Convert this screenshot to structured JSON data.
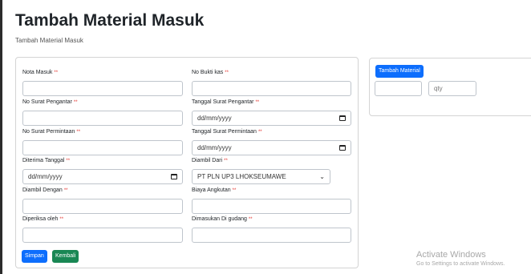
{
  "header": {
    "title": "Tambah Material Masuk",
    "breadcrumb": "Tambah Material Masuk"
  },
  "form": {
    "required_mark": "**",
    "nota_masuk": {
      "label": "Nota Masuk",
      "value": ""
    },
    "no_bukti_kas": {
      "label": "No Bukti kas",
      "value": ""
    },
    "no_surat_pengantar": {
      "label": "No Surat Pengantar",
      "value": ""
    },
    "tanggal_surat_pengantar": {
      "label": "Tanggal Surat Pengantar",
      "value": "dd/mm/yyyy"
    },
    "no_surat_permintaan": {
      "label": "No Surat Permintaan",
      "value": ""
    },
    "tanggal_surat_permintaan": {
      "label": "Tanggal Surat Permintaan",
      "value": "dd/mm/yyyy"
    },
    "diterima_tanggal": {
      "label": "Diterima Tanggal",
      "value": "dd/mm/yyyy"
    },
    "diambil_dari": {
      "label": "Diambil Dari",
      "value": "PT PLN UP3 LHOKSEUMAWE"
    },
    "diambil_dengan": {
      "label": "Diambil Dengan",
      "value": ""
    },
    "biaya_angkutan": {
      "label": "Biaya Angkutan",
      "value": ""
    },
    "diperiksa_oleh": {
      "label": "Diperiksa oleh",
      "value": ""
    },
    "dimasukan_di_gudang": {
      "label": "Dimasukan Di gudang",
      "value": ""
    },
    "submit_label": "Simpan",
    "back_label": "Kembali"
  },
  "material_panel": {
    "add_button_label": "Tambah Material",
    "material_value": "",
    "qty_placeholder": "qty"
  },
  "watermark": {
    "title": "Activate Windows",
    "subtitle": "Go to Settings to activate Windows."
  },
  "colors": {
    "primary": "#0d6efd",
    "success": "#198754",
    "required": "#e3342f"
  },
  "icons": {
    "date_picker": "calendar-icon",
    "select": "chevron-down-icon"
  }
}
